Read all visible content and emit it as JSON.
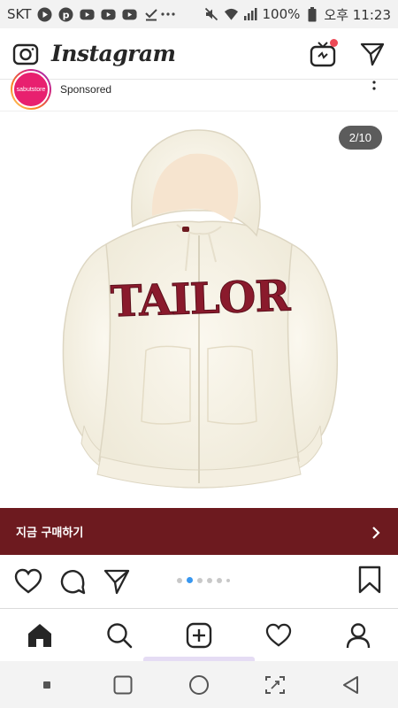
{
  "status_bar": {
    "carrier": "SKT",
    "battery": "100%",
    "time": "오후 11:23",
    "icons": [
      "play-icon",
      "pinterest-icon",
      "youtube-icon",
      "youtube-icon",
      "youtube-icon",
      "download-done-icon",
      "more-dots-icon",
      "mute-icon",
      "wifi-icon",
      "signal-icon"
    ]
  },
  "header": {
    "logo": "Instagram",
    "icons": [
      "camera-icon",
      "igtv-icon",
      "direct-message-icon"
    ],
    "notification_color": "#ed4956"
  },
  "post": {
    "avatar_text": "sabutstore",
    "sponsored_label": "Sponsored",
    "image_counter": "2/10",
    "garment_text": "TAILOR",
    "cta_label": "지금 구매하기",
    "cta_color": "#6d1a1f",
    "carousel_active_index": 1,
    "carousel_dot_count": 6
  },
  "bottom_nav": {
    "items": [
      "home-icon",
      "search-icon",
      "add-post-icon",
      "activity-icon",
      "profile-icon"
    ],
    "active": "home"
  },
  "system_nav": {
    "items": [
      "dot-icon",
      "recents-icon",
      "home-circle-icon",
      "screenshot-icon",
      "back-icon"
    ]
  }
}
